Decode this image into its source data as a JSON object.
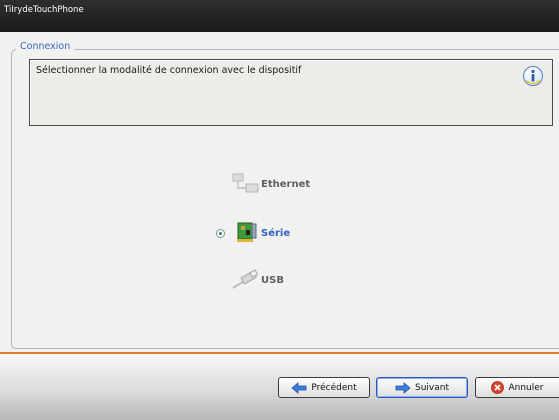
{
  "window": {
    "title": "TiIrydeTouchPhone"
  },
  "group": {
    "legend": "Connexion",
    "instruction": "Sélectionner la modalité de connexion avec le dispositif",
    "info_icon": "info-icon"
  },
  "options": [
    {
      "label": "Ethernet",
      "icon": "network-icon",
      "selected": false
    },
    {
      "label": "Série",
      "icon": "serial-card-icon",
      "selected": true
    },
    {
      "label": "USB",
      "icon": "usb-cable-icon",
      "selected": false
    }
  ],
  "footer": {
    "previous_label": "Précédent",
    "next_label": "Suivant",
    "cancel_label": "Annuler"
  },
  "colors": {
    "accent_separator": "#e07a2e",
    "legend_text": "#3a66c4",
    "selected_option": "#2f63c8"
  }
}
